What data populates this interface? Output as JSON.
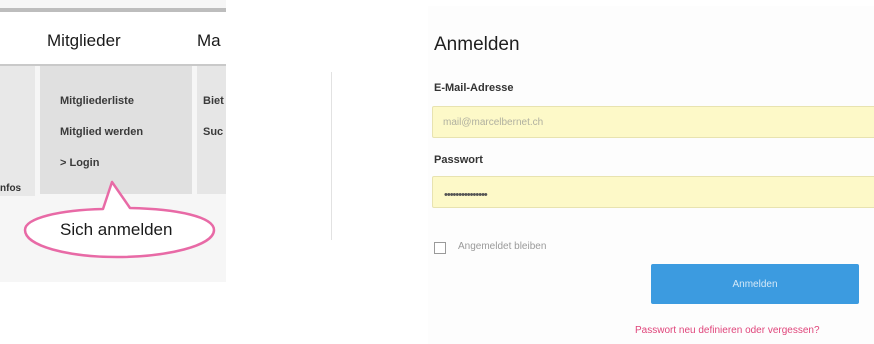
{
  "nav": {
    "tabs": [
      {
        "label": "Mitglieder"
      },
      {
        "label": "Ma"
      }
    ],
    "left_column_text": "nfos",
    "dropdown_items": [
      {
        "label": "Mitgliederliste"
      },
      {
        "label": "Mitglied werden"
      },
      {
        "label": "> Login"
      }
    ],
    "right_column_items": [
      {
        "label": "Biet"
      },
      {
        "label": "Suc"
      }
    ],
    "callout_label": "Sich anmelden",
    "callout_color": "#e86aa6"
  },
  "login": {
    "title": "Anmelden",
    "email": {
      "label": "E-Mail-Adresse",
      "value": "mail@marcelbernet.ch"
    },
    "password": {
      "label": "Passwort",
      "masked_value": "•••••••••••••••"
    },
    "remember_label": "Angemeldet bleiben",
    "remember_checked": false,
    "submit_label": "Anmelden",
    "forgot_link": "Passwort neu definieren oder vergessen?",
    "accent_color": "#3c9be0",
    "link_color": "#e0457b",
    "input_bg": "#fdf9c8"
  }
}
